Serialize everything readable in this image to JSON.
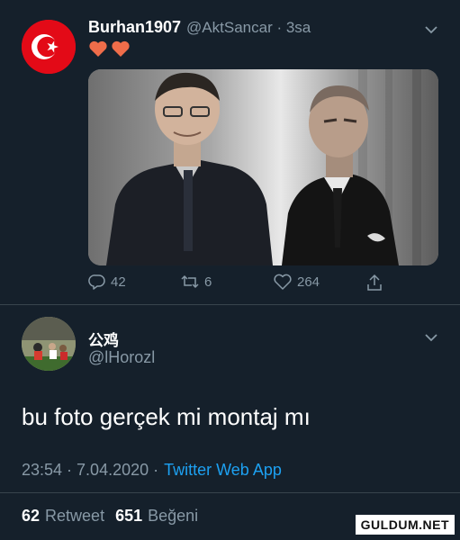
{
  "tweet1": {
    "display_name": "Burhan1907",
    "handle_time": "@AktSancar · 3sa",
    "avatar_icon": "turkish-flag-avatar",
    "emoji": "❤️❤️",
    "image_desc": "photo",
    "actions": {
      "reply_count": "42",
      "retweet_count": "6",
      "like_count": "264"
    }
  },
  "tweet2": {
    "display_name": "公鸡",
    "handle": "@lHorozl",
    "text": "bu foto gerçek mi montaj mı",
    "time": "23:54 · 7.04.2020 ·",
    "app": "Twitter Web App",
    "retweets": "62",
    "retweets_label": "Retweet",
    "likes": "651",
    "likes_label": "Beğeni"
  },
  "watermark": "GULDUM.NET",
  "colors": {
    "background": "#15202b",
    "muted": "#8899a6",
    "link": "#1da1f2",
    "flag_red": "#e30a17",
    "divider": "#38444d"
  }
}
